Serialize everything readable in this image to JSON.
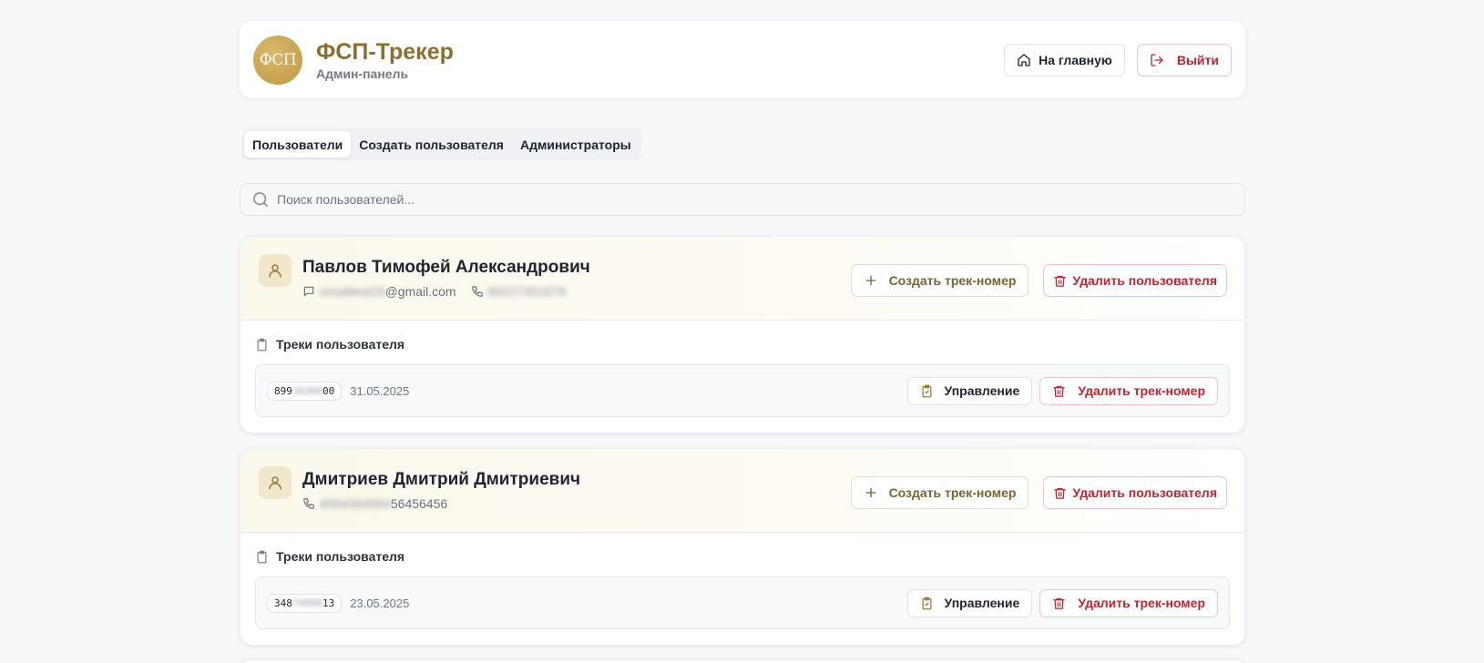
{
  "header": {
    "logo_text": "ФСП",
    "title": "ФСП-Трекер",
    "subtitle": "Админ-панель",
    "home_label": "На главную",
    "logout_label": "Выйти"
  },
  "tabs": [
    {
      "label": "Пользователи",
      "active": true
    },
    {
      "label": "Создать пользователя",
      "active": false
    },
    {
      "label": "Администраторы",
      "active": false
    }
  ],
  "search": {
    "placeholder": "Поиск пользователей..."
  },
  "users": [
    {
      "name": "Павлов Тимофей Александрович",
      "email_hidden": "emailtest25",
      "email_visible": "@gmail.com",
      "phone_hidden": "89227351678",
      "create_track_label": "Создать трек-номер",
      "delete_user_label": "Удалить пользователя",
      "tracks_label": "Треки пользователя",
      "tracks": [
        {
          "num_start": "899",
          "num_hidden": "26360",
          "num_end": "00",
          "date": "31.05.2025",
          "manage_label": "Управление",
          "delete_label": "Удалить трек-номер"
        }
      ]
    },
    {
      "name": "Дмитриев Дмитрий Дмитриевич",
      "phone_hidden": "4564364564",
      "phone_visible": "56456456",
      "create_track_label": "Создать трек-номер",
      "delete_user_label": "Удалить пользователя",
      "tracks_label": "Треки пользователя",
      "tracks": [
        {
          "num_start": "348",
          "num_hidden": "74999",
          "num_end": "13",
          "date": "23.05.2025",
          "manage_label": "Управление",
          "delete_label": "Удалить трек-номер"
        }
      ]
    }
  ],
  "colors": {
    "brand": "#8c6f2e",
    "logo": "#c9a650",
    "danger": "#c4232f",
    "page_bg": "#f7f8fa"
  }
}
